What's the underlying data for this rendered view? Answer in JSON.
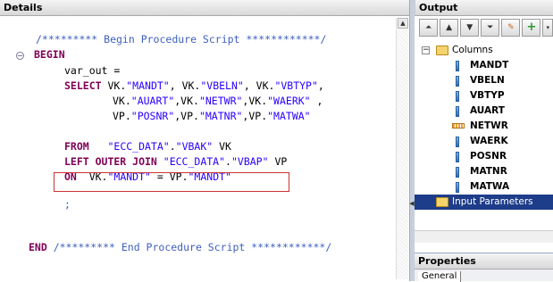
{
  "details": {
    "title": "Details",
    "code_lines": [
      {
        "tokens": [
          {
            "t": "/********* Begin Procedure Script ************/",
            "c": "cm"
          }
        ]
      },
      {
        "tokens": [
          {
            "t": "BEGIN",
            "c": "kw"
          }
        ]
      },
      {
        "tokens": [
          {
            "t": "var_out =",
            "c": "plain"
          }
        ]
      },
      {
        "tokens": [
          {
            "t": "SELECT ",
            "c": "kw"
          },
          {
            "t": "VK.",
            "c": "plain"
          },
          {
            "t": "\"MANDT\"",
            "c": "str"
          },
          {
            "t": ", VK.",
            "c": "plain"
          },
          {
            "t": "\"VBELN\"",
            "c": "str"
          },
          {
            "t": ", VK.",
            "c": "plain"
          },
          {
            "t": "\"VBTYP\"",
            "c": "str"
          },
          {
            "t": ",",
            "c": "plain"
          }
        ]
      },
      {
        "tokens": [
          {
            "t": "VK.",
            "c": "plain"
          },
          {
            "t": "\"AUART\"",
            "c": "str"
          },
          {
            "t": ",VK.",
            "c": "plain"
          },
          {
            "t": "\"NETWR\"",
            "c": "str"
          },
          {
            "t": ",VK.",
            "c": "plain"
          },
          {
            "t": "\"WAERK\"",
            "c": "str"
          },
          {
            "t": " ,",
            "c": "plain"
          }
        ]
      },
      {
        "tokens": [
          {
            "t": "VP.",
            "c": "plain"
          },
          {
            "t": "\"POSNR\"",
            "c": "str"
          },
          {
            "t": ",VP.",
            "c": "plain"
          },
          {
            "t": "\"MATNR\"",
            "c": "str"
          },
          {
            "t": ",VP.",
            "c": "plain"
          },
          {
            "t": "\"MATWA\"",
            "c": "str"
          }
        ]
      },
      {
        "tokens": [
          {
            "t": "FROM   ",
            "c": "kw"
          },
          {
            "t": "\"ECC_DATA\"",
            "c": "str"
          },
          {
            "t": ".",
            "c": "plain"
          },
          {
            "t": "\"VBAK\"",
            "c": "str"
          },
          {
            "t": " VK",
            "c": "plain"
          }
        ]
      },
      {
        "tokens": [
          {
            "t": "LEFT OUTER JOIN ",
            "c": "kw"
          },
          {
            "t": "\"ECC_DATA\"",
            "c": "str"
          },
          {
            "t": ".",
            "c": "plain"
          },
          {
            "t": "\"VBAP\"",
            "c": "str"
          },
          {
            "t": " VP",
            "c": "plain"
          }
        ]
      },
      {
        "tokens": [
          {
            "t": "ON  ",
            "c": "kw"
          },
          {
            "t": "VK.",
            "c": "plain"
          },
          {
            "t": "\"MANDT\"",
            "c": "str"
          },
          {
            "t": " = VP.",
            "c": "plain"
          },
          {
            "t": "\"MANDT\"",
            "c": "str"
          }
        ]
      },
      {
        "tokens": [
          {
            "t": ";",
            "c": "cm"
          }
        ]
      },
      {
        "tokens": [
          {
            "t": "END ",
            "c": "kw"
          },
          {
            "t": "/********* End Procedure Script ************/",
            "c": "cm"
          }
        ]
      }
    ]
  },
  "output": {
    "title": "Output",
    "toolbar": [
      {
        "name": "move-top-button",
        "icon": "⏶"
      },
      {
        "name": "move-up-button",
        "icon": "▲"
      },
      {
        "name": "move-down-button",
        "icon": "▼"
      },
      {
        "name": "move-bottom-button",
        "icon": "⏷"
      },
      {
        "name": "edit-button",
        "icon": "✎"
      },
      {
        "name": "add-button",
        "icon": "+"
      }
    ],
    "columns_label": "Columns",
    "columns": [
      "MANDT",
      "VBELN",
      "VBTYP",
      "AUART",
      "NETWR",
      "WAERK",
      "POSNR",
      "MATNR",
      "MATWA"
    ],
    "measure_column": "NETWR",
    "input_parameters_label": "Input Parameters"
  },
  "properties": {
    "title": "Properties",
    "tab_general": "General"
  }
}
